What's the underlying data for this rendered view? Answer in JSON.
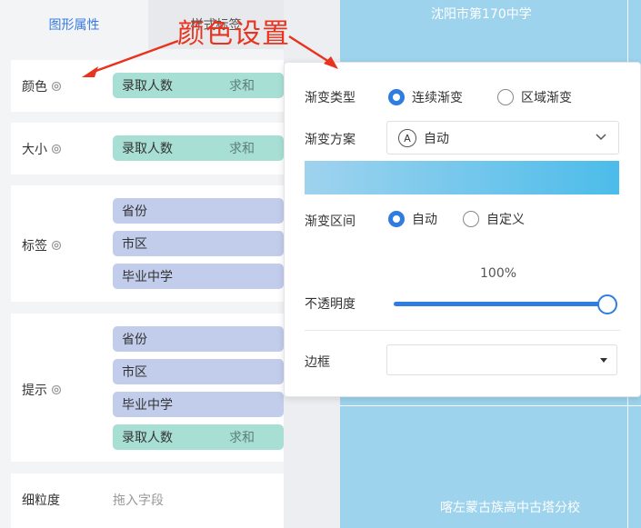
{
  "tabs": [
    {
      "label": "图形属性"
    },
    {
      "label": "样式标签"
    }
  ],
  "properties": {
    "color": {
      "label": "颜色",
      "field": "录取人数",
      "agg": "求和"
    },
    "size": {
      "label": "大小",
      "field": "录取人数",
      "agg": "求和"
    },
    "tag": {
      "label": "标签",
      "fields": [
        "省份",
        "市区",
        "毕业中学"
      ]
    },
    "tooltip": {
      "label": "提示",
      "fields": [
        "省份",
        "市区",
        "毕业中学"
      ],
      "measure": {
        "field": "录取人数",
        "agg": "求和"
      }
    },
    "granularity": {
      "label": "细粒度",
      "placeholder": "拖入字段"
    }
  },
  "annotation": {
    "text": "颜色设置",
    "color": "#e8331f"
  },
  "popup": {
    "gradient_type": {
      "label": "渐变类型",
      "options": [
        "连续渐变",
        "区域渐变"
      ],
      "selected": "连续渐变"
    },
    "gradient_scheme": {
      "label": "渐变方案",
      "value": "自动",
      "icon_letter": "A"
    },
    "gradient_colors": [
      "#9fd3ee",
      "#4cbcea"
    ],
    "gradient_range": {
      "label": "渐变区间",
      "options": [
        "自动",
        "自定义"
      ],
      "selected": "自动"
    },
    "opacity": {
      "label": "不透明度",
      "value_text": "100%",
      "value": 1.0
    },
    "border": {
      "label": "边框",
      "value": ""
    }
  },
  "viz": {
    "top_label": "沈阳市第170中学",
    "bottom_label": "喀左蒙古族高中古塔分校",
    "fill": "#9dd3ec"
  },
  "accent": "#2f7de1"
}
